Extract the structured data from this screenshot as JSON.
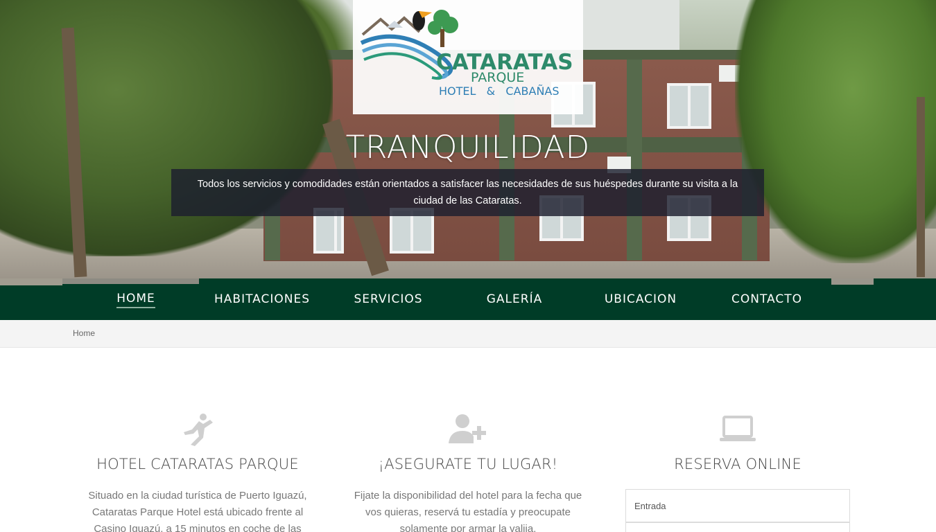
{
  "logo": {
    "name": "CATARATAS",
    "sub": "PARQUE",
    "tagline": "HOTEL   &   CABAÑAS"
  },
  "hero": {
    "title": "TRANQUILIDAD",
    "caption": "Todos los servicios y comodidades están orientados a satisfacer las necesidades de sus huéspedes durante su visita a la ciudad de las Cataratas."
  },
  "nav": {
    "items": [
      {
        "label": "HOME",
        "active": true
      },
      {
        "label": "HABITACIONES"
      },
      {
        "label": "SERVICIOS"
      },
      {
        "label": "GALERÍA"
      },
      {
        "label": "UBICACION"
      },
      {
        "label": "CONTACTO"
      }
    ]
  },
  "breadcrumb": {
    "current": "Home"
  },
  "columns": [
    {
      "icon": "dancer-icon",
      "title": "HOTEL CATARATAS PARQUE",
      "text": "Situado en la ciudad turística de Puerto Iguazú, Cataratas Parque Hotel está ubicado frente al Casino Iguazú, a 15 minutos en coche de las"
    },
    {
      "icon": "add-user-icon",
      "title": "¡ASEGURATE TU LUGAR!",
      "text": "Fijate la disponibilidad del hotel para la fecha que vos quieras, reservá tu estadía y preocupate solamente por armar la valija."
    },
    {
      "icon": "laptop-icon",
      "title": "RESERVA ONLINE",
      "text": ""
    }
  ],
  "booking": {
    "checkin_placeholder": "Entrada"
  },
  "colors": {
    "nav_bg": "#003c27",
    "caption_bg": "#1c1e2e",
    "logo_green": "#2e8a6a",
    "logo_blue": "#2f7fb5"
  }
}
